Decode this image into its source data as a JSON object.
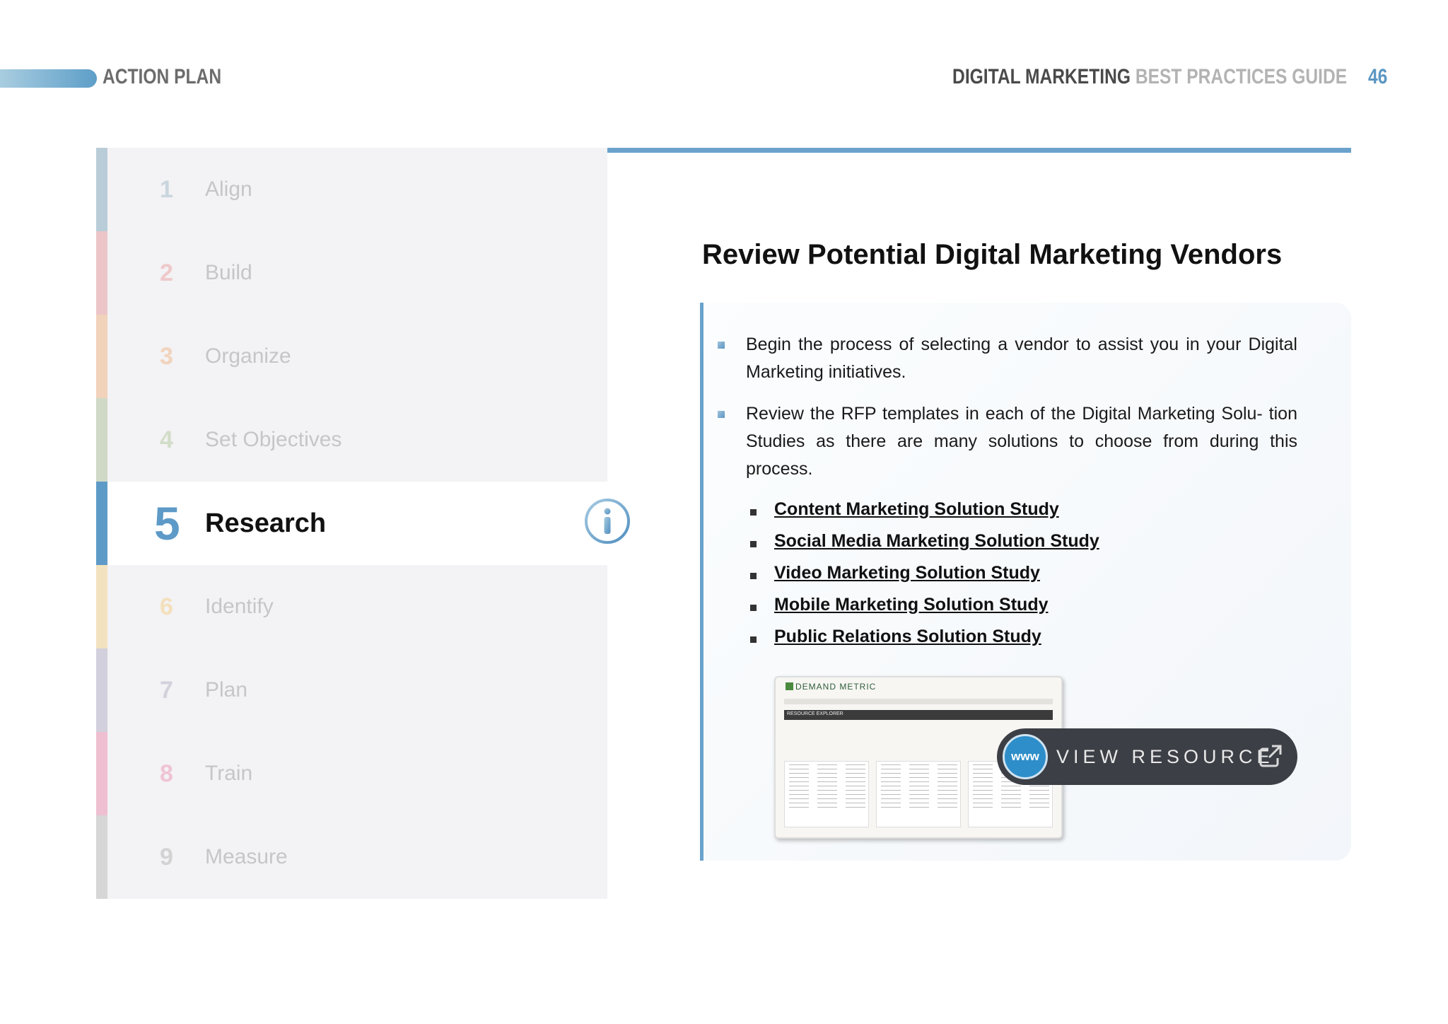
{
  "header": {
    "section": "ACTION PLAN",
    "guide_bold": "DIGITAL MARKETING",
    "guide_light": "BEST PRACTICES GUIDE",
    "page_number": "46"
  },
  "nav": {
    "items": [
      {
        "num": "1",
        "label": "Align",
        "color": "#b9cdd8"
      },
      {
        "num": "2",
        "label": "Build",
        "color": "#ecc5c8"
      },
      {
        "num": "3",
        "label": "Organize",
        "color": "#f1d2bb"
      },
      {
        "num": "4",
        "label": "Set Objectives",
        "color": "#cfd9c6"
      },
      {
        "num": "5",
        "label": "Research",
        "color": "#5e9ac7"
      },
      {
        "num": "6",
        "label": "Identify",
        "color": "#f3e2bf"
      },
      {
        "num": "7",
        "label": "Plan",
        "color": "#d2d0dc"
      },
      {
        "num": "8",
        "label": "Train",
        "color": "#eebfd0"
      },
      {
        "num": "9",
        "label": "Measure",
        "color": "#d6d6d6"
      }
    ],
    "active_index": 4
  },
  "content": {
    "title": "Review Potential Digital Marketing Vendors",
    "bullets": [
      "Begin the process of selecting a vendor to assist you in your Digital Marketing initiatives.",
      "Review the RFP templates in each of the Digital Marketing Solu- tion Studies as there are many solutions to choose from during this process."
    ],
    "links": [
      "Content Marketing Solution Study",
      "Social Media Marketing Solution Study",
      "Video Marketing Solution Study",
      "Mobile Marketing Solution Study",
      "Public Relations Solution Study"
    ],
    "thumbnail": {
      "brand": "DEMAND METRIC",
      "bar_label": "RESOURCE EXPLORER"
    },
    "view_resource": {
      "badge": "www",
      "label": "VIEW RESOURCE"
    }
  }
}
